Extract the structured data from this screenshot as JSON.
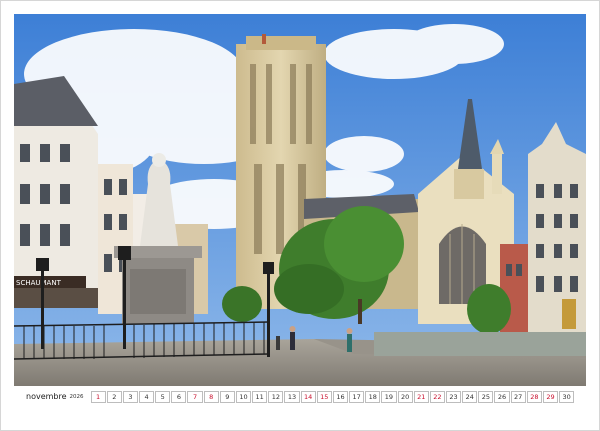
{
  "calendar": {
    "month": "novembre",
    "year": "2026",
    "days": [
      {
        "n": "1",
        "weekend": true
      },
      {
        "n": "2",
        "weekend": false
      },
      {
        "n": "3",
        "weekend": false
      },
      {
        "n": "4",
        "weekend": false
      },
      {
        "n": "5",
        "weekend": false
      },
      {
        "n": "6",
        "weekend": false
      },
      {
        "n": "7",
        "weekend": true
      },
      {
        "n": "8",
        "weekend": true
      },
      {
        "n": "9",
        "weekend": false
      },
      {
        "n": "10",
        "weekend": false
      },
      {
        "n": "11",
        "weekend": false
      },
      {
        "n": "12",
        "weekend": false
      },
      {
        "n": "13",
        "weekend": false
      },
      {
        "n": "14",
        "weekend": true
      },
      {
        "n": "15",
        "weekend": true
      },
      {
        "n": "16",
        "weekend": false
      },
      {
        "n": "17",
        "weekend": false
      },
      {
        "n": "18",
        "weekend": false
      },
      {
        "n": "19",
        "weekend": false
      },
      {
        "n": "20",
        "weekend": false
      },
      {
        "n": "21",
        "weekend": true
      },
      {
        "n": "22",
        "weekend": true
      },
      {
        "n": "23",
        "weekend": false
      },
      {
        "n": "24",
        "weekend": false
      },
      {
        "n": "25",
        "weekend": false
      },
      {
        "n": "26",
        "weekend": false
      },
      {
        "n": "27",
        "weekend": false
      },
      {
        "n": "28",
        "weekend": true
      },
      {
        "n": "29",
        "weekend": true
      },
      {
        "n": "30",
        "weekend": false
      }
    ]
  },
  "photo": {
    "shop_sign": "SCHAUMANT"
  },
  "colors": {
    "sky": "#4f8fdc",
    "weekend": "#c8102e",
    "stone": "#d8c9a0",
    "foliage": "#3f7d2c"
  }
}
